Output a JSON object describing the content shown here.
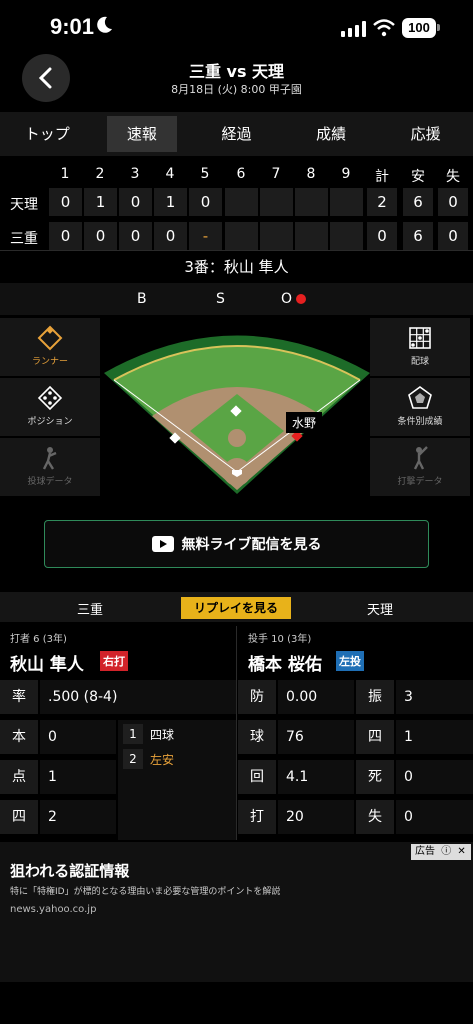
{
  "status": {
    "time": "9:01",
    "battery": "100"
  },
  "header": {
    "title": "三重 vs 天理",
    "subtitle": "8月18日 (火) 8:00 甲子園"
  },
  "tabs": [
    "トップ",
    "速報",
    "経過",
    "成績",
    "応援"
  ],
  "scoreboard": {
    "innings": [
      "1",
      "2",
      "3",
      "4",
      "5",
      "6",
      "7",
      "8",
      "9"
    ],
    "total_headers": [
      "計",
      "安",
      "失"
    ],
    "rows": [
      {
        "team": "天理",
        "scores": [
          "0",
          "1",
          "0",
          "1",
          "0",
          "",
          "",
          "",
          ""
        ],
        "totals": [
          "2",
          "6",
          "0"
        ]
      },
      {
        "team": "三重",
        "scores": [
          "0",
          "0",
          "0",
          "0",
          "-",
          "",
          "",
          "",
          ""
        ],
        "totals": [
          "0",
          "6",
          "0"
        ]
      }
    ]
  },
  "current_batter": "3番：秋山 隼人",
  "count": {
    "b": "B",
    "s": "S",
    "o": "O",
    "outs": 1
  },
  "left_menu": [
    "ランナー",
    "ポジション",
    "投球データ"
  ],
  "right_menu": [
    "配球",
    "条件別成績",
    "打撃データ"
  ],
  "runner_on_field": "水野",
  "live_button": "無料ライブ配信を見る",
  "team_bar": {
    "left": "三重",
    "replay": "リプレイを見る",
    "right": "天理"
  },
  "batter": {
    "header": "打者 6 (3年)",
    "name": "秋山 隼人",
    "hand": "右打",
    "stats": [
      {
        "label": "率",
        "value": ".500 (8-4)"
      },
      {
        "label": "本",
        "value": "0"
      },
      {
        "label": "点",
        "value": "1"
      },
      {
        "label": "四",
        "value": "2"
      }
    ],
    "at_bats": [
      {
        "n": "1",
        "result": "四球"
      },
      {
        "n": "2",
        "result": "左安"
      }
    ]
  },
  "pitcher": {
    "header": "投手 10 (3年)",
    "name": "橋本 桜佑",
    "hand": "左投",
    "stats": [
      {
        "label": "防",
        "value": "0.00"
      },
      {
        "label": "振",
        "value": "3"
      },
      {
        "label": "球",
        "value": "76"
      },
      {
        "label": "四",
        "value": "1"
      },
      {
        "label": "回",
        "value": "4.1"
      },
      {
        "label": "死",
        "value": "0"
      },
      {
        "label": "打",
        "value": "20"
      },
      {
        "label": "失",
        "value": "0"
      }
    ]
  },
  "ad": {
    "title": "狙われる認証情報",
    "desc": "特に「特権ID」が標的となる理由いま必要な管理のポイントを解説",
    "domain": "news.yahoo.co.jp",
    "badge": "広告"
  },
  "colors": {
    "accent": "#e8a23a",
    "replay": "#e8b21a",
    "right_hand": "#d2232a",
    "left_hand": "#1f6fb5",
    "field": "#5aa545"
  }
}
